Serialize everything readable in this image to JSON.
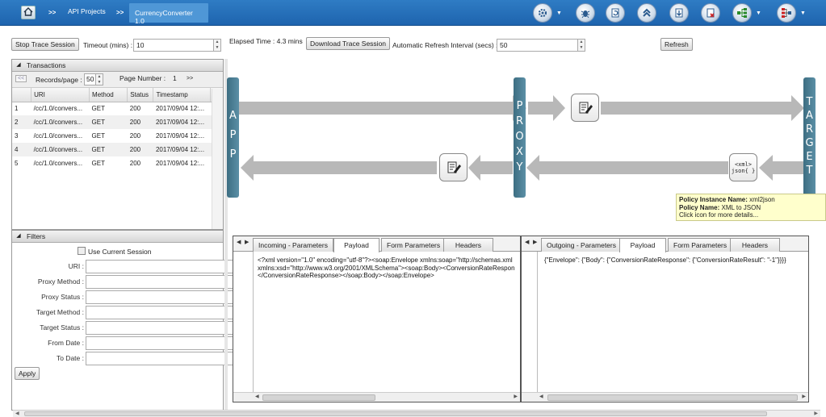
{
  "breadcrumb": {
    "items": [
      "API Projects"
    ],
    "active": "CurrencyConverter 1.0",
    "separator": ">>"
  },
  "toolbar_icons": [
    "settings-gear-icon",
    "bug-icon",
    "refresh-document-icon",
    "collapse-up-icon",
    "download-icon",
    "delete-document-icon",
    "flow-tree-icon",
    "hierarchy-icon"
  ],
  "controls": {
    "stop_trace": "Stop Trace Session",
    "timeout_label": "Timeout (mins) :",
    "timeout_value": "10",
    "elapsed_label": "Elapsed Time : 4.3 mins",
    "download_trace": "Download Trace Session",
    "refresh_interval_label": "Automatic Refresh Interval (secs) :",
    "refresh_interval_value": "50",
    "refresh": "Refresh"
  },
  "transactions": {
    "title": "Transactions",
    "prev": "<<",
    "next": ">>",
    "records_label": "Records/page :",
    "records_value": "50",
    "page_label": "Page Number :",
    "page_value": "1",
    "columns": [
      "",
      "URI",
      "Method",
      "Status",
      "Timestamp"
    ],
    "rows": [
      [
        "1",
        "/cc/1.0/convers...",
        "GET",
        "200",
        "2017/09/04 12:..."
      ],
      [
        "2",
        "/cc/1.0/convers...",
        "GET",
        "200",
        "2017/09/04 12:..."
      ],
      [
        "3",
        "/cc/1.0/convers...",
        "GET",
        "200",
        "2017/09/04 12:..."
      ],
      [
        "4",
        "/cc/1.0/convers...",
        "GET",
        "200",
        "2017/09/04 12:..."
      ],
      [
        "5",
        "/cc/1.0/convers...",
        "GET",
        "200",
        "2017/09/04 12:..."
      ]
    ]
  },
  "filters": {
    "title": "Filters",
    "use_current": "Use Current Session",
    "fields": [
      "URI :",
      "Proxy Method :",
      "Proxy Status :",
      "Target Method :",
      "Target Status :",
      "From Date :",
      "To Date :"
    ],
    "apply": "Apply"
  },
  "flow": {
    "app": [
      "A",
      "P",
      "P"
    ],
    "proxy": [
      "P",
      "R",
      "O",
      "X",
      "Y"
    ],
    "target": [
      "T",
      "A",
      "R",
      "G",
      "E",
      "T"
    ],
    "xml_icon_top": "<xml>",
    "xml_icon_bottom": "json{ }"
  },
  "tooltip": {
    "name_label": "Policy Instance Name:",
    "name_value": "xml2json",
    "policy_label": "Policy Name:",
    "policy_value": "XML to JSON",
    "hint": "Click icon for more details..."
  },
  "incoming": {
    "tabs": [
      "Incoming - Parameters",
      "Payload",
      "Form Parameters",
      "Headers"
    ],
    "active_tab": "Payload",
    "payload": "<?xml version=\"1.0\" encoding=\"utf-8\"?><soap:Envelope xmlns:soap=\"http://schemas.xml\nxmlns:xsd=\"http://www.w3.org/2001/XMLSchema\"><soap:Body><ConversionRateRespon\n</ConversionRateResponse></soap:Body></soap:Envelope>"
  },
  "outgoing": {
    "tabs": [
      "Outgoing - Parameters",
      "Payload",
      "Form Parameters",
      "Headers"
    ],
    "active_tab": "Payload",
    "payload": "{\"Envelope\": {\"Body\": {\"ConversionRateResponse\": {\"ConversionRateResult\": \"-1\"}}}}"
  },
  "colors": {
    "topbar": "#1e64ae",
    "flow_bar": "#4a7f95",
    "tooltip_bg": "#ffffcc"
  }
}
